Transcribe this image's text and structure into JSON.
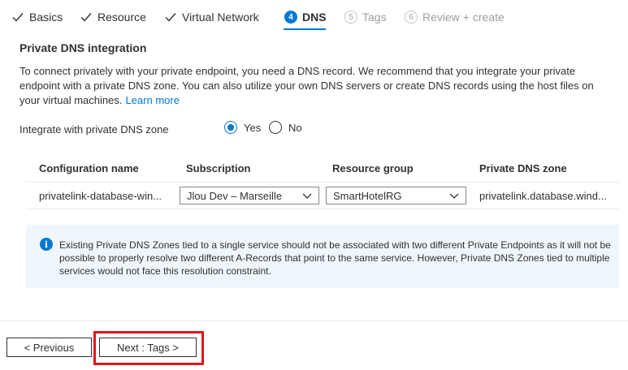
{
  "tabs": [
    {
      "label": "Basics",
      "state": "done"
    },
    {
      "label": "Resource",
      "state": "done"
    },
    {
      "label": "Virtual Network",
      "state": "done"
    },
    {
      "label": "DNS",
      "state": "active",
      "number": "4"
    },
    {
      "label": "Tags",
      "state": "future",
      "number": "5"
    },
    {
      "label": "Review + create",
      "state": "future",
      "number": "6"
    }
  ],
  "section": {
    "title": "Private DNS integration",
    "description": "To connect privately with your private endpoint, you need a DNS record. We recommend that you integrate your private endpoint with a private DNS zone. You can also utilize your own DNS servers or create DNS records using the host files on your virtual machines.",
    "learn_more": "Learn more"
  },
  "integrate": {
    "label": "Integrate with private DNS zone",
    "options": [
      "Yes",
      "No"
    ],
    "selected": "Yes"
  },
  "grid": {
    "headers": [
      "Configuration name",
      "Subscription",
      "Resource group",
      "Private DNS zone"
    ],
    "rows": [
      {
        "configuration_name": "privatelink-database-win...",
        "subscription": "Jlou Dev – Marseille",
        "resource_group": "SmartHotelRG",
        "private_dns_zone": "privatelink.database.wind..."
      }
    ]
  },
  "info": {
    "text": "Existing Private DNS Zones tied to a single service should not be associated with two different Private Endpoints as it will not be possible to properly resolve two different A-Records that point to the same service. However, Private DNS Zones tied to multiple services would not face this resolution constraint."
  },
  "footer": {
    "previous_label": "< Previous",
    "next_label": "Next : Tags >"
  },
  "colors": {
    "accent": "#0078d4",
    "highlight": "#e0141e",
    "info_background": "#eff6fc"
  }
}
